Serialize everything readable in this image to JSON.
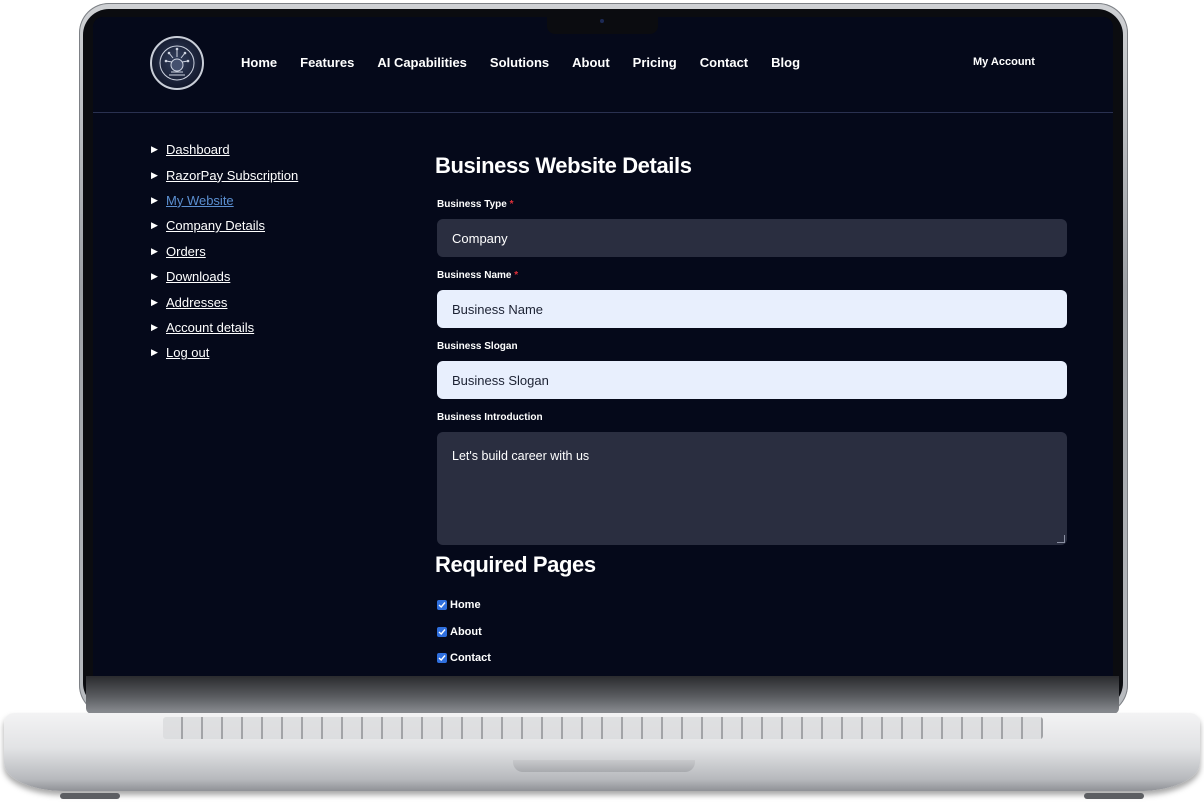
{
  "header": {
    "nav": [
      {
        "label": "Home"
      },
      {
        "label": "Features"
      },
      {
        "label": "AI Capabilities"
      },
      {
        "label": "Solutions"
      },
      {
        "label": "About"
      },
      {
        "label": "Pricing"
      },
      {
        "label": "Contact"
      },
      {
        "label": "Blog"
      }
    ],
    "account_label": "My Account",
    "logo_icon": "circuit-emblem-logo"
  },
  "sidebar": {
    "items": [
      {
        "label": "Dashboard",
        "active": false
      },
      {
        "label": "RazorPay Subscription",
        "active": false
      },
      {
        "label": "My Website",
        "active": true
      },
      {
        "label": "Company Details",
        "active": false
      },
      {
        "label": "Orders",
        "active": false
      },
      {
        "label": "Downloads",
        "active": false
      },
      {
        "label": "Addresses",
        "active": false
      },
      {
        "label": "Account details",
        "active": false
      },
      {
        "label": "Log out",
        "active": false
      }
    ],
    "arrow_icon": "triangle-right-icon"
  },
  "form": {
    "title": "Business Website Details",
    "business_type": {
      "label": "Business Type",
      "required": "*",
      "value": "Company"
    },
    "business_name": {
      "label": "Business Name",
      "required": "*",
      "placeholder": "Business Name"
    },
    "business_slogan": {
      "label": "Business Slogan",
      "placeholder": "Business Slogan"
    },
    "business_intro": {
      "label": "Business Introduction",
      "value": "Let's build career with us"
    },
    "pages_title": "Required Pages",
    "pages": [
      {
        "label": "Home",
        "checked": true
      },
      {
        "label": "About",
        "checked": true
      },
      {
        "label": "Contact",
        "checked": true
      }
    ]
  },
  "colors": {
    "screen_bg": "#05091a",
    "input_dark": "#2a2e40",
    "input_light": "#e8effd",
    "active_link": "#5b8fd1",
    "required": "#e0303a",
    "checkbox": "#2f6fde"
  }
}
